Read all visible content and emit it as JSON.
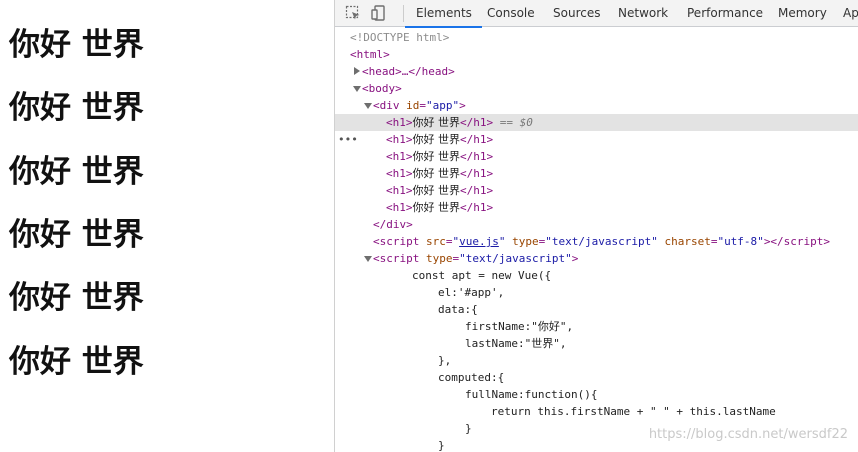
{
  "page": {
    "headings": [
      "你好 世界",
      "你好 世界",
      "你好 世界",
      "你好 世界",
      "你好 世界",
      "你好 世界"
    ]
  },
  "devtools": {
    "tabs": [
      "Elements",
      "Console",
      "Sources",
      "Network",
      "Performance",
      "Memory",
      "Ap"
    ],
    "active_tab": "Elements",
    "icons": [
      "inspect-icon",
      "device-toggle-icon"
    ],
    "accent_color": "#1a73e8",
    "dom": {
      "doctype": "<!DOCTYPE html>",
      "html_open": "<html>",
      "head": "<head>…</head>",
      "body_open": "<body>",
      "div_open": "<div id=\"app\">",
      "h1_text": "你好 世界",
      "selected_marker": "== $0",
      "div_close": "</div>",
      "script_src": "vue.js",
      "script_type": "text/javascript",
      "script_charset": "utf-8",
      "script_type2": "text/javascript",
      "js_lines": [
        "const apt = new Vue({",
        "el:'#app',",
        "data:{",
        "firstName:\"你好\",",
        "lastName:\"世界\",",
        "},",
        "computed:{",
        "fullName:function(){",
        "return this.firstName + \" \" + this.lastName",
        "}",
        "}"
      ]
    }
  },
  "watermark": "https://blog.csdn.net/wersdf22"
}
